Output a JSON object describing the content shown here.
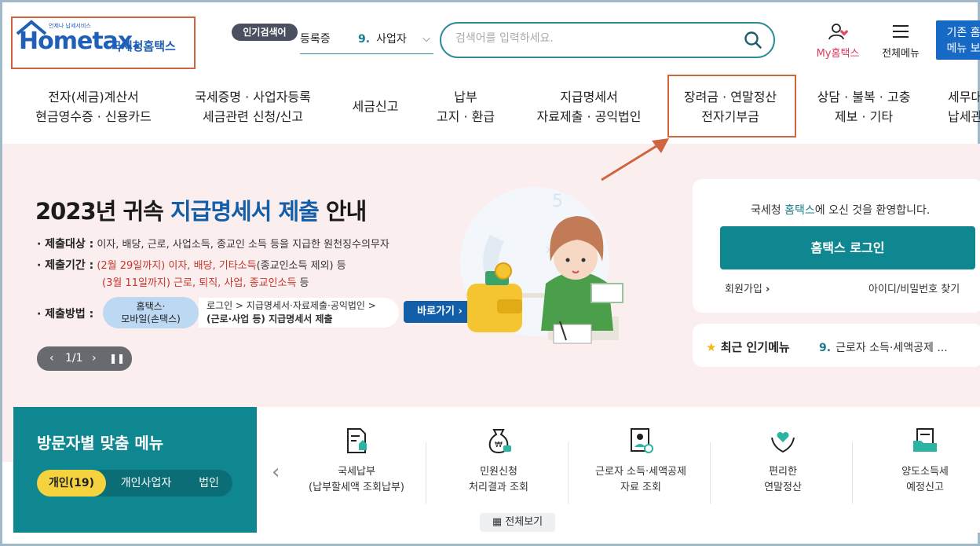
{
  "header": {
    "logo_text": "Hometax.",
    "logo_tagline": "언제나 납세서비스",
    "logo_kor": "국세청홈택스",
    "popular_badge": "인기검색어",
    "popular_prev": "등록증",
    "popular_rank": "9.",
    "popular_word": "사업자",
    "search_placeholder": "검색어를 입력하세요.",
    "my_hometax": "My홈택스",
    "all_menu": "전체메뉴",
    "old_menu_line1": "기존 홈",
    "old_menu_line2": "메뉴 보"
  },
  "nav": [
    {
      "line1": "전자(세금)계산서",
      "line2": "현금영수증 · 신용카드"
    },
    {
      "line1": "국세증명 · 사업자등록",
      "line2": "세금관련 신청/신고"
    },
    {
      "line1": "세금신고",
      "line2": ""
    },
    {
      "line1": "납부",
      "line2": "고지 · 환급"
    },
    {
      "line1": "지급명세서",
      "line2": "자료제출 · 공익법인"
    },
    {
      "line1": "장려금 · 연말정산",
      "line2": "전자기부금"
    },
    {
      "line1": "상담 · 불복 · 고충",
      "line2": "제보 · 기타"
    },
    {
      "line1": "세무대",
      "line2": "납세관"
    }
  ],
  "banner": {
    "title_a": "2023년 귀속 ",
    "title_b": "지급명세서 제출",
    "title_c": " 안내",
    "target_label": "· 제출대상 :",
    "target_text": "이자, 배당, 근로, 사업소득, 종교인 소득 등을 지급한 원천징수의무자",
    "period_label": "· 제출기간 :",
    "period1_red": "(2월 29일까지) 이자, 배당, 기타소득",
    "period1_rest": "(종교인소득 제외) 등",
    "period2_red": "(3월 11일까지) 근로, 퇴직, 사업, 종교인소득",
    "period2_rest": " 등",
    "method_label": "· 제출방법 :",
    "method_pill1": "홈택스·",
    "method_pill2": "모바일(손택스)",
    "method_desc1": "로그인 > 지급명세서·자료제출·공익법인 >",
    "method_desc2": "(근로·사업 등) 지급명세서 제출",
    "go_button": "바로가기 ›",
    "pager_text": "1/1"
  },
  "login": {
    "welcome_a": "국세청 ",
    "welcome_b": "홈택스",
    "welcome_c": "에 오신 것을 환영합니다.",
    "login_button": "홈택스 로그인",
    "join": "회원가입",
    "find": "아이디/비밀번호 찾기",
    "recent_title": "최근 인기메뉴",
    "recent_rank": "9.",
    "recent_item": "근로자 소득·세액공제 ..."
  },
  "visitor": {
    "title": "방문자별 맞춤 메뉴",
    "tabs": [
      "개인(19)",
      "개인사업자",
      "법인"
    ]
  },
  "quick": [
    {
      "icon": "tax-payment-icon",
      "line1": "국세납부",
      "line2": "(납부할세액 조회납부)"
    },
    {
      "icon": "money-bag-icon",
      "line1": "민원신청",
      "line2": "처리결과 조회"
    },
    {
      "icon": "worker-document-icon",
      "line1": "근로자 소득·세액공제",
      "line2": "자료 조회"
    },
    {
      "icon": "heart-hands-icon",
      "line1": "편리한",
      "line2": "연말정산"
    },
    {
      "icon": "folder-document-icon",
      "line1": "양도소득세",
      "line2": "예정신고"
    }
  ],
  "view_all": "전체보기"
}
